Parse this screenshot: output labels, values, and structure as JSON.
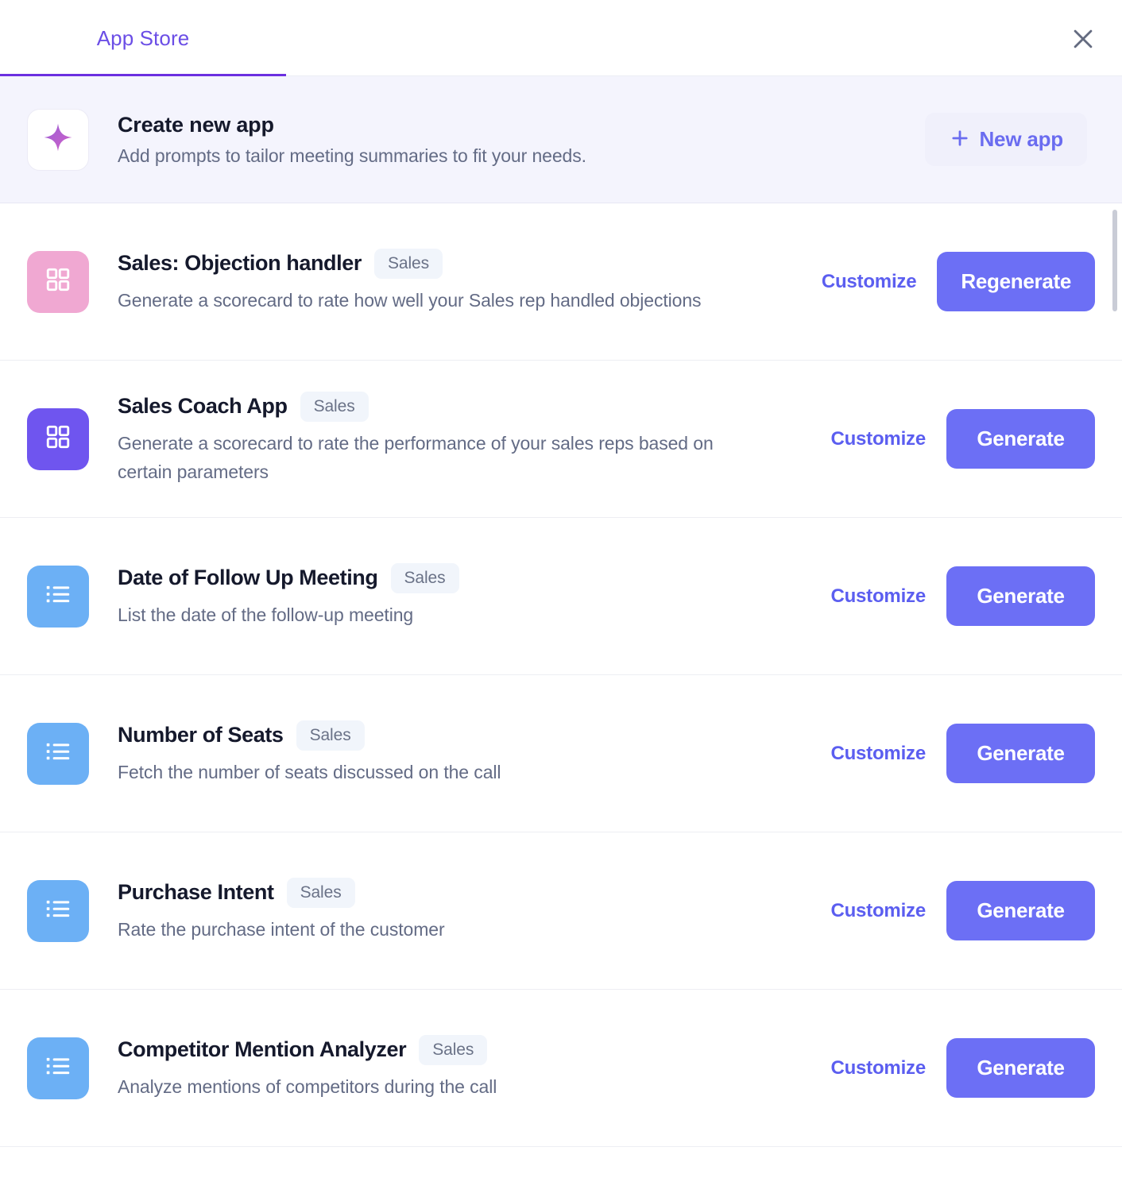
{
  "header": {
    "tabs": [
      {
        "label": "App Store",
        "active": true
      }
    ],
    "close_icon": "close-icon"
  },
  "banner": {
    "icon": "sparkle-icon",
    "title": "Create new app",
    "subtitle": "Add prompts to tailor meeting summaries to fit your needs.",
    "button": {
      "label": "New app",
      "icon": "plus-icon"
    }
  },
  "colors": {
    "accent": "#6c6ff5",
    "tab_active": "#6b2fe0",
    "link": "#5b5ef0",
    "banner_bg": "#f4f4fd",
    "icon_pink": "#f0a8d2",
    "icon_purple": "#6f55ef",
    "icon_blue": "#6cb0f5",
    "tag_bg": "#f1f5fb",
    "tag_text": "#6a7287",
    "title_text": "#15192c",
    "body_text": "#636b85"
  },
  "apps": [
    {
      "icon": "grid-icon",
      "icon_color": "#f0a8d2",
      "title": "Sales: Objection handler",
      "tag": "Sales",
      "description": "Generate a scorecard to rate how well your Sales rep handled objections",
      "customize_label": "Customize",
      "action_label": "Regenerate"
    },
    {
      "icon": "grid-icon",
      "icon_color": "#6f55ef",
      "title": "Sales Coach App",
      "tag": "Sales",
      "description": "Generate a scorecard to rate the performance of your sales reps based on certain parameters",
      "customize_label": "Customize",
      "action_label": "Generate"
    },
    {
      "icon": "list-icon",
      "icon_color": "#6cb0f5",
      "title": "Date of Follow Up Meeting",
      "tag": "Sales",
      "description": "List the date of the follow-up meeting",
      "customize_label": "Customize",
      "action_label": "Generate"
    },
    {
      "icon": "list-icon",
      "icon_color": "#6cb0f5",
      "title": "Number of Seats",
      "tag": "Sales",
      "description": "Fetch the number of seats discussed on the call",
      "customize_label": "Customize",
      "action_label": "Generate"
    },
    {
      "icon": "list-icon",
      "icon_color": "#6cb0f5",
      "title": "Purchase Intent",
      "tag": "Sales",
      "description": "Rate the purchase intent of the customer",
      "customize_label": "Customize",
      "action_label": "Generate"
    },
    {
      "icon": "list-icon",
      "icon_color": "#6cb0f5",
      "title": "Competitor Mention Analyzer",
      "tag": "Sales",
      "description": "Analyze mentions of competitors during the call",
      "customize_label": "Customize",
      "action_label": "Generate"
    }
  ]
}
